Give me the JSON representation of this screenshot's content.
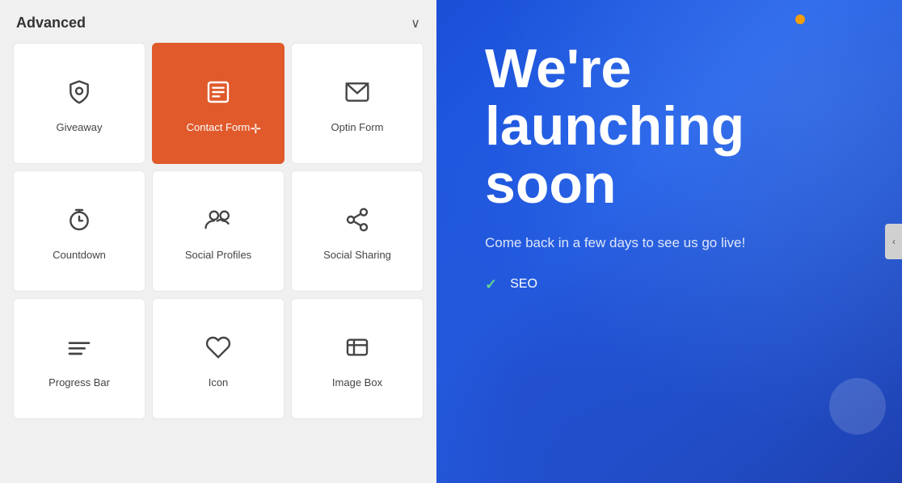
{
  "panel": {
    "title": "Advanced",
    "chevron": "∨",
    "collapse_arrow": "‹"
  },
  "widgets": [
    {
      "id": "giveaway",
      "label": "Giveaway",
      "icon": "shield",
      "active": false
    },
    {
      "id": "contact-form",
      "label": "Contact Form",
      "icon": "form",
      "active": true
    },
    {
      "id": "optin-form",
      "label": "Optin Form",
      "icon": "email",
      "active": false
    },
    {
      "id": "countdown",
      "label": "Countdown",
      "icon": "timer",
      "active": false
    },
    {
      "id": "social-profiles",
      "label": "Social Profiles",
      "icon": "people",
      "active": false
    },
    {
      "id": "social-sharing",
      "label": "Social Sharing",
      "icon": "share",
      "active": false
    },
    {
      "id": "progress-bar",
      "label": "Progress Bar",
      "icon": "bars",
      "active": false
    },
    {
      "id": "icon",
      "label": "Icon",
      "icon": "heart",
      "active": false
    },
    {
      "id": "image-box",
      "label": "Image Box",
      "icon": "imagebox",
      "active": false
    }
  ],
  "preview": {
    "heading": "We're launching soon",
    "subtext": "Come back in a few days to see us go live!",
    "checklist": [
      "SEO"
    ]
  },
  "colors": {
    "active_bg": "#e05a2b",
    "panel_bg": "#f0f0f0",
    "preview_bg_start": "#1a4fd6",
    "preview_bg_end": "#1e40af",
    "check_color": "#60d394",
    "dot_color": "#f59e0b"
  }
}
